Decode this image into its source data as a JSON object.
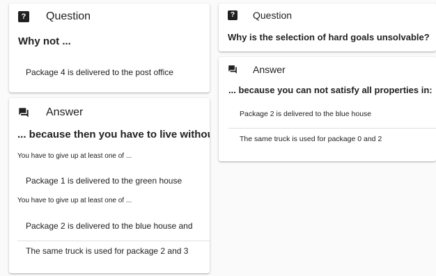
{
  "left": {
    "question": {
      "header": "Question",
      "title": "Why not ...",
      "items": [
        "Package 4 is delivered to the post office"
      ]
    },
    "answer": {
      "header": "Answer",
      "title": "... because then you have to live without:",
      "groups": [
        {
          "note": "You have to give up at least one of ...",
          "items": [
            "Package 1 is delivered to the green house"
          ]
        },
        {
          "note": "You have to give up at least one of ...",
          "items": [
            "Package 2 is delivered to the blue house and",
            "The same truck is used for package 2 and 3"
          ]
        }
      ]
    }
  },
  "right": {
    "question": {
      "header": "Question",
      "title": "Why is the selection of hard goals unsolvable?"
    },
    "answer": {
      "header": "Answer",
      "title": "... because you can not satisfy all properties in:",
      "items": [
        "Package 2 is delivered to the blue house",
        "The same truck is used for package 0 and 2"
      ]
    }
  },
  "icons": {
    "question": "help-box-icon",
    "answer": "forum-icon"
  }
}
